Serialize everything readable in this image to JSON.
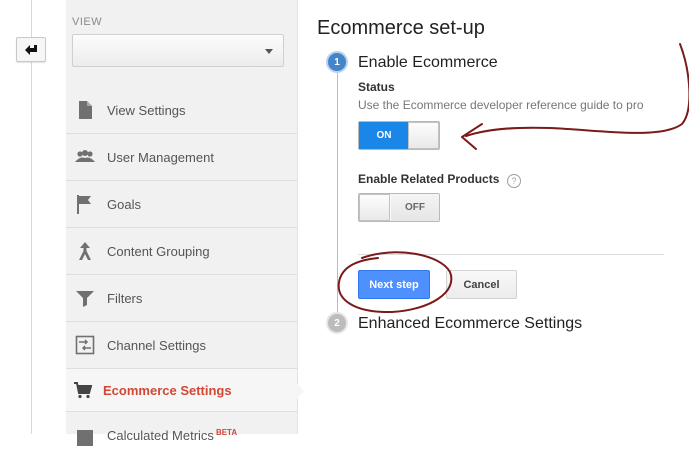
{
  "sidebar": {
    "view_label": "VIEW",
    "view_value": "",
    "items": [
      {
        "label": "View Settings",
        "icon": "document-icon"
      },
      {
        "label": "User Management",
        "icon": "users-icon"
      },
      {
        "label": "Goals",
        "icon": "flag-icon"
      },
      {
        "label": "Content Grouping",
        "icon": "content-grouping-icon"
      },
      {
        "label": "Filters",
        "icon": "filter-icon"
      },
      {
        "label": "Channel Settings",
        "icon": "channel-settings-icon"
      },
      {
        "label": "Ecommerce Settings",
        "icon": "cart-icon",
        "active": true
      },
      {
        "label": "Calculated Metrics",
        "icon": "calculated-metrics-icon",
        "badge": "BETA"
      }
    ]
  },
  "main": {
    "title": "Ecommerce set-up",
    "step1": {
      "number": "1",
      "title": "Enable Ecommerce",
      "status_label": "Status",
      "status_help": "Use the Ecommerce developer reference guide to pro",
      "status_toggle": "ON",
      "related_label": "Enable Related Products",
      "related_help": "?",
      "related_toggle": "OFF",
      "next_button": "Next step",
      "cancel_button": "Cancel"
    },
    "step2": {
      "number": "2",
      "title": "Enhanced Ecommerce Settings"
    }
  },
  "colors": {
    "accent_blue": "#4d90fe",
    "toggle_on": "#1a86e8",
    "active_nav": "#d14836",
    "annotation": "#7b1a1a"
  }
}
